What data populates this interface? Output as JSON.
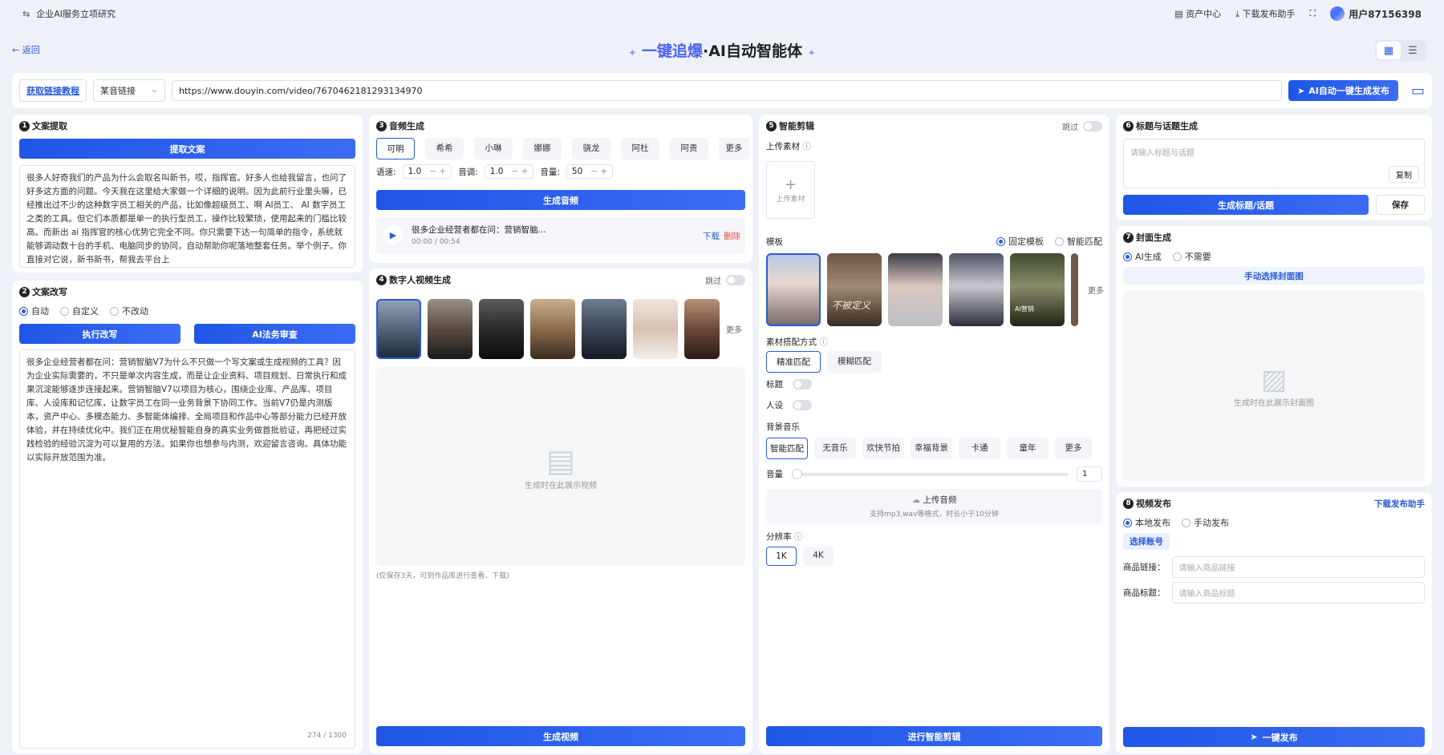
{
  "topbar": {
    "title": "企业AI服务立项研究",
    "assets": "资产中心",
    "download_helper": "下载发布助手",
    "user": "用户87156398"
  },
  "header": {
    "back": "返回",
    "title_prefix": "一键追爆",
    "title_suffix": "·AI自动智能体"
  },
  "linkbar": {
    "tutorial": "获取链接教程",
    "platform": "某音链接",
    "url": "https://www.douyin.com/video/7670462181293134970",
    "auto_button": "AI自动一键生成发布"
  },
  "step1": {
    "num": "1",
    "title": "文案提取",
    "button": "提取文案",
    "text": "很多人好奇我们的产品为什么会取名叫新书，哎，指挥官。好多人也给我留言，也问了好多这方面的问题。今天我在这里给大家做一个详细的说明。因为此前行业里头嘛，已经推出过不少的这种数字员工相关的产品，比如像超级员工、啊 AI员工、 AI 数字员工之类的工具。但它们本质都是单一的执行型员工，操作比较繁琐，使用起来的门槛比较高。而新出 ai 指挥官的核心优势它完全不同。你只需要下达一句简单的指令，系统就能够调动数十台的手机、电脑同步的协同，自动帮助你呢落地整套任务。举个例子。你直接对它说，新书新书，帮我去平台上"
  },
  "step2": {
    "num": "2",
    "title": "文案改写",
    "modes": [
      "自动",
      "自定义",
      "不改动"
    ],
    "run": "执行改写",
    "legal": "AI法务审查",
    "text": "很多企业经营者都在问：营销智脑V7为什么不只做一个写文案或生成视频的工具？因为企业实际需要的，不只是单次内容生成，而是让企业资料、项目规划、日常执行和成果沉淀能够逐步连接起来。营销智脑V7以项目为核心，围绕企业库、产品库、项目库、人设库和记忆库，让数字员工在同一业务背景下协同工作。当前V7仍是内测版本，资产中心、多模态能力、多智能体编排、全局项目和作品中心等部分能力已经开放体验，并在持续优化中。我们正在用优秘智能自身的真实业务做首批验证，再把经过实践检验的经验沉淀为可以复用的方法。如果你也想参与内测，欢迎留言咨询。具体功能以实际开放范围为准。",
    "counter": "274  /  1300"
  },
  "step3": {
    "num": "3",
    "title": "音频生成",
    "voices": [
      "可明",
      "希希",
      "小琳",
      "娜娜",
      "骁龙",
      "阿杜",
      "阿贵"
    ],
    "more": "更多",
    "speed_label": "语速:",
    "speed": "1.0",
    "pitch_label": "音调:",
    "pitch": "1.0",
    "volume_label": "音量:",
    "volume": "50",
    "generate": "生成音频",
    "audio_title": "很多企业经营者都在问：营销智脑...",
    "audio_time": "00:00  /  00:54",
    "download": "下载",
    "delete": "删除"
  },
  "step4": {
    "num": "4",
    "title": "数字人视频生成",
    "skip": "跳过",
    "more": "更多",
    "placeholder": "生成时在此展示视频",
    "note": "(仅保存3天，可到作品库进行查看、下载)",
    "generate": "生成视频"
  },
  "step5": {
    "num": "5",
    "title": "智能剪辑",
    "skip": "跳过",
    "upload_label": "上传素材",
    "upload_btn": "上传素材",
    "template_label": "模板",
    "template_modes": [
      "固定模板",
      "智能匹配"
    ],
    "more": "更多",
    "template_texts": [
      "",
      "不被定义",
      "",
      "",
      "AI营销"
    ],
    "match_label": "素材搭配方式",
    "match_modes": [
      "精准匹配",
      "模糊匹配"
    ],
    "title_label": "标题",
    "persona_label": "人设",
    "bgm_label": "背景音乐",
    "bgm": [
      "智能匹配",
      "无音乐",
      "欢快节拍",
      "幸福背景",
      "卡通",
      "童年"
    ],
    "bgm_more": "更多",
    "volume_label": "音量",
    "volume": "1",
    "upload_audio": "上传音频",
    "upload_hint": "支持mp3,wav等格式，时长小于10分钟",
    "resolution_label": "分辨率",
    "resolutions": [
      "1K",
      "4K"
    ],
    "run": "进行智能剪辑"
  },
  "step6": {
    "num": "6",
    "title": "标题与话题生成",
    "placeholder": "请输入标题与话题",
    "copy": "复制",
    "generate": "生成标题/话题",
    "save": "保存"
  },
  "step7": {
    "num": "7",
    "title": "封面生成",
    "modes": [
      "AI生成",
      "不需要"
    ],
    "manual": "手动选择封面图",
    "placeholder": "生成时在此展示封面图"
  },
  "step8": {
    "num": "8",
    "title": "视频发布",
    "helper": "下载发布助手",
    "modes": [
      "本地发布",
      "手动发布"
    ],
    "account": "选择账号",
    "goods_link_label": "商品链接：",
    "goods_link_ph": "请输入商品链接",
    "goods_title_label": "商品标题：",
    "goods_title_ph": "请输入商品标题",
    "publish": "一键发布"
  }
}
